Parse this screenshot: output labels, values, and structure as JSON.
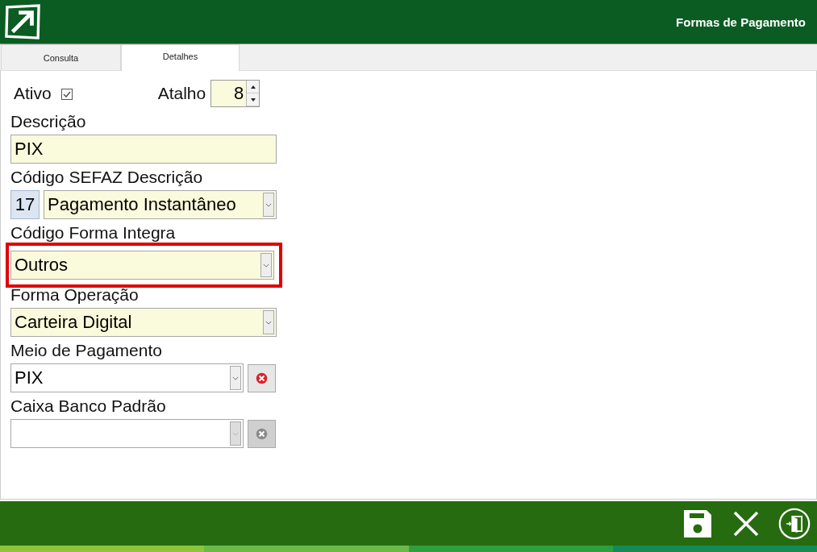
{
  "header": {
    "title": "Formas de Pagamento"
  },
  "tabs": [
    {
      "label": "Consulta",
      "selected": false
    },
    {
      "label": "Detalhes",
      "selected": true
    }
  ],
  "ativo": {
    "label": "Ativo",
    "checked": true
  },
  "atalho": {
    "label": "Atalho",
    "value": "8"
  },
  "fields": [
    {
      "kind": "text",
      "label": "Descrição",
      "value": "PIX",
      "required": true,
      "highlighted": false
    },
    {
      "kind": "code-combo",
      "label": "Código SEFAZ Descrição",
      "code": "17",
      "value": "Pagamento Instantâneo",
      "required": true,
      "highlighted": false
    },
    {
      "kind": "combo",
      "label": "Código Forma Integra",
      "value": "Outros",
      "required": true,
      "highlighted": true
    },
    {
      "kind": "combo",
      "label": "Forma Operação",
      "value": "Carteira Digital",
      "required": true,
      "highlighted": false
    },
    {
      "kind": "clear-combo",
      "label": "Meio de Pagamento",
      "value": "PIX",
      "required": false,
      "highlighted": false,
      "disabled": false
    },
    {
      "kind": "clear-combo",
      "label": "Caixa Banco Padrão",
      "required": false,
      "highlighted": false,
      "disabled": true
    }
  ]
}
